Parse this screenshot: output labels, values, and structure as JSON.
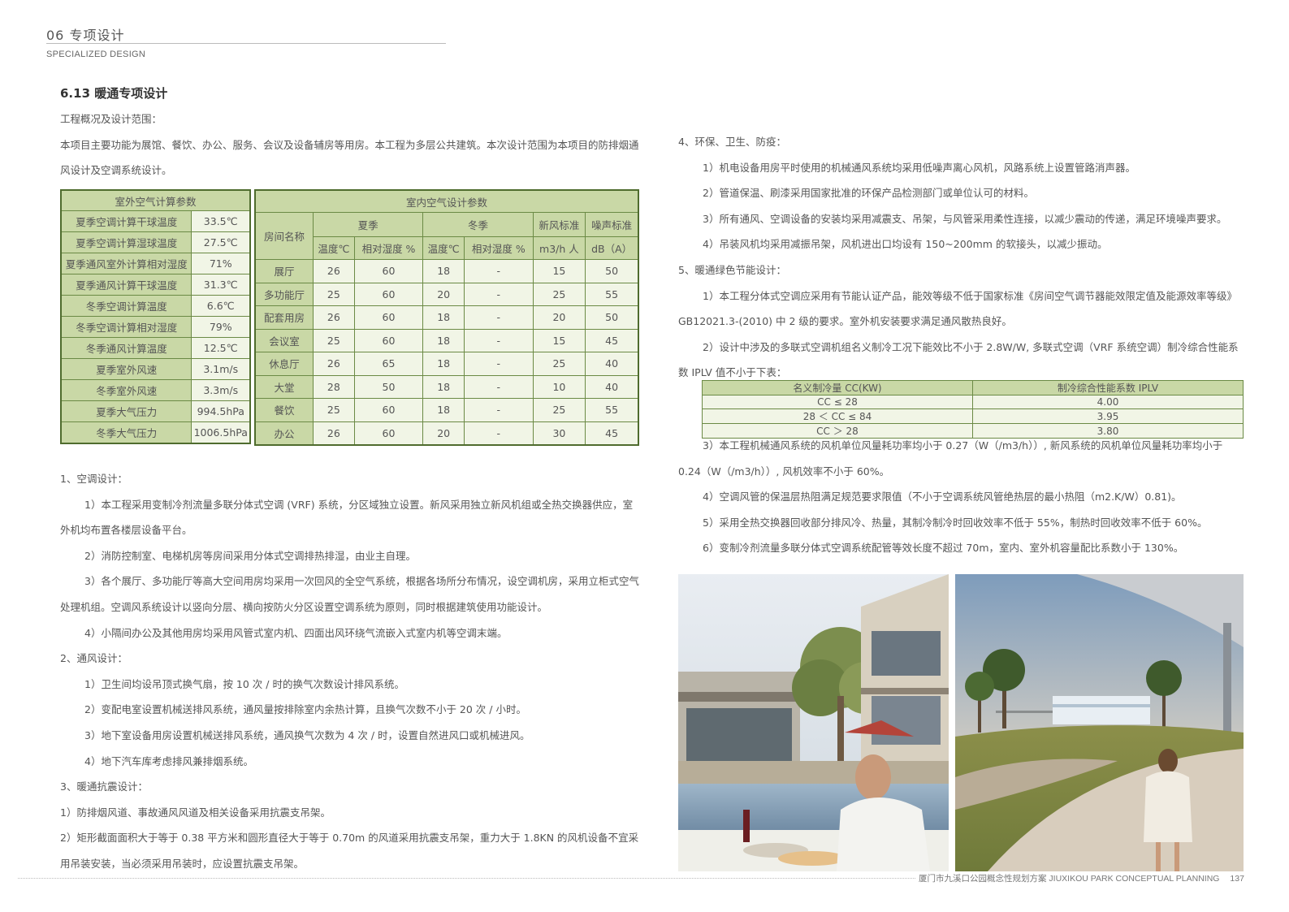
{
  "header": {
    "chapter": "06 专项设计",
    "chapter_en": "SPECIALIZED DESIGN"
  },
  "section_title": "6.13  暖通专项设计",
  "left": {
    "p_overview_label": "工程概况及设计范围：",
    "p_overview": "本项目主要功能为展馆、餐饮、办公、服务、会议及设备辅房等用房。本工程为多层公共建筑。本次设计范围为本项目的防排烟通风设计及空调系统设计。",
    "s1": "1、空调设计：",
    "s1_1": "1）本工程采用变制冷剂流量多联分体式空调 (VRF) 系统，分区域独立设置。新风采用独立新风机组或全热交换器供应，室外机均布置各楼层设备平台。",
    "s1_2": "2）消防控制室、电梯机房等房间采用分体式空调排热排湿，由业主自理。",
    "s1_3": "3）各个展厅、多功能厅等高大空间用房均采用一次回风的全空气系统，根据各场所分布情况，设空调机房，采用立柜式空气处理机组。空调风系统设计以竖向分层、横向按防火分区设置空调系统为原则，同时根据建筑使用功能设计。",
    "s1_4": "4）小隔间办公及其他用房均采用风管式室内机、四面出风环绕气流嵌入式室内机等空调末端。",
    "s2": "2、通风设计：",
    "s2_1": "1）卫生间均设吊顶式换气扇，按 10 次 / 时的换气次数设计排风系统。",
    "s2_2": "2）变配电室设置机械送排风系统，通风量按排除室内余热计算，且换气次数不小于 20 次 / 小时。",
    "s2_3": "3）地下室设备用房设置机械送排风系统，通风换气次数为 4 次 / 时，设置自然进风口或机械进风。",
    "s2_4": "4）地下汽车库考虑排风兼排烟系统。",
    "s3": "3、暖通抗震设计：",
    "s3_1": "1）防排烟风道、事故通风风道及相关设备采用抗震支吊架。",
    "s3_2": "2）矩形截面面积大于等于 0.38 平方米和圆形直径大于等于 0.70m 的风道采用抗震支吊架，重力大于 1.8KN 的风机设备不宜采用吊装安装，当必须采用吊装时，应设置抗震支吊架。"
  },
  "outdoor_table": {
    "title": "室外空气计算参数",
    "rows": [
      [
        "夏季空调计算干球温度",
        "33.5℃"
      ],
      [
        "夏季空调计算湿球温度",
        "27.5℃"
      ],
      [
        "夏季通风室外计算相对湿度",
        "71%"
      ],
      [
        "夏季通风计算干球温度",
        "31.3℃"
      ],
      [
        "冬季空调计算温度",
        "6.6℃"
      ],
      [
        "冬季空调计算相对湿度",
        "79%"
      ],
      [
        "冬季通风计算温度",
        "12.5℃"
      ],
      [
        "夏季室外风速",
        "3.1m/s"
      ],
      [
        "冬季室外风速",
        "3.3m/s"
      ],
      [
        "夏季大气压力",
        "994.5hPa"
      ],
      [
        "冬季大气压力",
        "1006.5hPa"
      ]
    ]
  },
  "indoor_table": {
    "title": "室内空气设计参数",
    "h_room": "房间名称",
    "h_summer": "夏季",
    "h_winter": "冬季",
    "h_fresh": "新风标准",
    "h_noise": "噪声标准",
    "sub": [
      "温度℃",
      "相对湿度 %",
      "温度℃",
      "相对湿度 %",
      "m3/h 人",
      "dB（A）"
    ],
    "rows": [
      [
        "展厅",
        "26",
        "60",
        "18",
        "-",
        "15",
        "50"
      ],
      [
        "多功能厅",
        "25",
        "60",
        "20",
        "-",
        "25",
        "55"
      ],
      [
        "配套用房",
        "26",
        "60",
        "18",
        "-",
        "20",
        "50"
      ],
      [
        "会议室",
        "25",
        "60",
        "18",
        "-",
        "15",
        "45"
      ],
      [
        "休息厅",
        "26",
        "65",
        "18",
        "-",
        "25",
        "40"
      ],
      [
        "大堂",
        "28",
        "50",
        "18",
        "-",
        "10",
        "40"
      ],
      [
        "餐饮",
        "25",
        "60",
        "18",
        "-",
        "25",
        "55"
      ],
      [
        "办公",
        "26",
        "60",
        "20",
        "-",
        "30",
        "45"
      ]
    ]
  },
  "right": {
    "s4": "4、环保、卫生、防疫：",
    "s4_1": "1）机电设备用房平时使用的机械通风系统均采用低噪声离心风机，风路系统上设置管路消声器。",
    "s4_2": "2）管道保温、刷漆采用国家批准的环保产品检测部门或单位认可的材料。",
    "s4_3": "3）所有通风、空调设备的安装均采用减震支、吊架，与风管采用柔性连接，以减少震动的传递，满足环境噪声要求。",
    "s4_4": "4）吊装风机均采用减振吊架，风机进出口均设有 150~200mm 的软接头，以减少振动。",
    "s5": "5、暖通绿色节能设计：",
    "s5_1": "1）本工程分体式空调应采用有节能认证产品，能效等级不低于国家标准《房间空气调节器能效限定值及能源效率等级》GB12021.3-(2010) 中 2 级的要求。室外机安装要求满足通风散热良好。",
    "s5_2": "2）设计中涉及的多联式空调机组名义制冷工况下能效比不小于 2.8W/W, 多联式空调（VRF 系统空调）制冷综合性能系数 IPLV 值不小于下表：",
    "s5_3": "3）本工程机械通风系统的风机单位风量耗功率均小于 0.27（W（/m3/h））, 新风系统的风机单位风量耗功率均小于 0.24（W（/m3/h））, 风机效率不小于 60%。",
    "s5_4": "4）空调风管的保温层热阻满足规范要求限值（不小于空调系统风管绝热层的最小热阻（m2.K/W）0.81)。",
    "s5_5": "5）采用全热交换器回收部分排风冷、热量，其制冷制冷时回收效率不低于 55%，制热时回收效率不低于 60%。",
    "s5_6": "6）变制冷剂流量多联分体式空调系统配管等效长度不超过 70m，室内、室外机容量配比系数小于 130%。"
  },
  "iplv_table": {
    "h1": "名义制冷量 CC(KW)",
    "h2": "制冷综合性能系数 IPLV",
    "rows": [
      [
        "CC ≤ 28",
        "4.00"
      ],
      [
        "28 ＜ CC ≤ 84",
        "3.95"
      ],
      [
        "CC ＞ 28",
        "3.80"
      ]
    ]
  },
  "footer": {
    "text": "厦门市九溪口公园概念性规划方案 JIUXIKOU PARK CONCEPTUAL PLANNING",
    "page": "137"
  },
  "colors": {
    "table_header": "#c9d8a6",
    "table_body": "#f1f5e6",
    "table_border": "#4f6c2e"
  }
}
